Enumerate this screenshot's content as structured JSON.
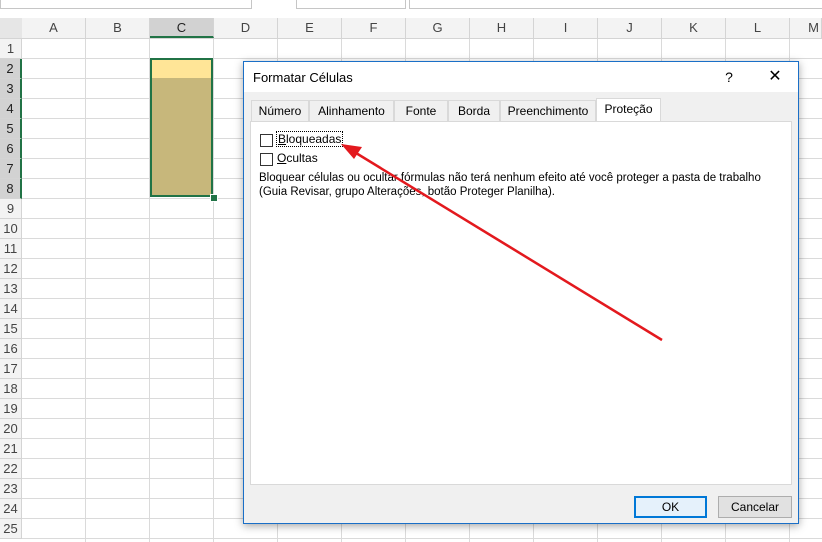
{
  "spreadsheet": {
    "columns": [
      "A",
      "B",
      "C",
      "D",
      "E",
      "F",
      "G",
      "H",
      "I",
      "J",
      "K",
      "L",
      "M"
    ],
    "selected_column": "C",
    "rows": [
      "1",
      "2",
      "3",
      "4",
      "5",
      "6",
      "7",
      "8",
      "9",
      "10",
      "11",
      "12",
      "13",
      "14",
      "15",
      "16",
      "17",
      "18",
      "19",
      "20",
      "21",
      "22",
      "23",
      "24",
      "25"
    ],
    "selected_rows": [
      "2",
      "3",
      "4",
      "5",
      "6",
      "7",
      "8"
    ],
    "colors": {
      "selection_border": "#217346",
      "active_cell_fill": "#ffe597",
      "range_fill": "#c7b77b",
      "annotation_arrow": "#e3191e"
    }
  },
  "dialog": {
    "title": "Formatar Células",
    "help_label": "?",
    "close_label": "✕",
    "tabs": [
      {
        "label": "Número"
      },
      {
        "label": "Alinhamento"
      },
      {
        "label": "Fonte"
      },
      {
        "label": "Borda"
      },
      {
        "label": "Preenchimento"
      },
      {
        "label": "Proteção",
        "active": true
      }
    ],
    "checkboxes": {
      "locked": {
        "label_first": "B",
        "label_rest": "loqueadas",
        "checked": false
      },
      "hidden": {
        "label_first": "O",
        "label_rest": "cultas",
        "checked": false
      }
    },
    "note": "Bloquear células ou ocultar fórmulas não terá nenhum efeito até você proteger a pasta de trabalho (Guia Revisar, grupo Alterações, botão Proteger Planilha).",
    "ok_label": "OK",
    "cancel_label": "Cancelar"
  }
}
